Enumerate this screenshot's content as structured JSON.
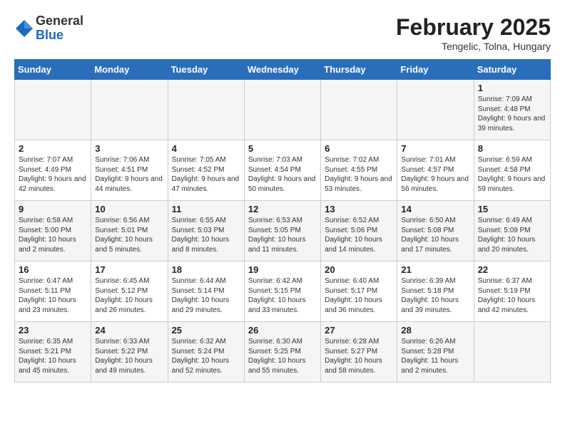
{
  "header": {
    "logo_general": "General",
    "logo_blue": "Blue",
    "title": "February 2025",
    "subtitle": "Tengelic, Tolna, Hungary"
  },
  "days_of_week": [
    "Sunday",
    "Monday",
    "Tuesday",
    "Wednesday",
    "Thursday",
    "Friday",
    "Saturday"
  ],
  "weeks": [
    [
      {
        "day": "",
        "info": ""
      },
      {
        "day": "",
        "info": ""
      },
      {
        "day": "",
        "info": ""
      },
      {
        "day": "",
        "info": ""
      },
      {
        "day": "",
        "info": ""
      },
      {
        "day": "",
        "info": ""
      },
      {
        "day": "1",
        "info": "Sunrise: 7:09 AM\nSunset: 4:48 PM\nDaylight: 9 hours and 39 minutes."
      }
    ],
    [
      {
        "day": "2",
        "info": "Sunrise: 7:07 AM\nSunset: 4:49 PM\nDaylight: 9 hours and 42 minutes."
      },
      {
        "day": "3",
        "info": "Sunrise: 7:06 AM\nSunset: 4:51 PM\nDaylight: 9 hours and 44 minutes."
      },
      {
        "day": "4",
        "info": "Sunrise: 7:05 AM\nSunset: 4:52 PM\nDaylight: 9 hours and 47 minutes."
      },
      {
        "day": "5",
        "info": "Sunrise: 7:03 AM\nSunset: 4:54 PM\nDaylight: 9 hours and 50 minutes."
      },
      {
        "day": "6",
        "info": "Sunrise: 7:02 AM\nSunset: 4:55 PM\nDaylight: 9 hours and 53 minutes."
      },
      {
        "day": "7",
        "info": "Sunrise: 7:01 AM\nSunset: 4:57 PM\nDaylight: 9 hours and 56 minutes."
      },
      {
        "day": "8",
        "info": "Sunrise: 6:59 AM\nSunset: 4:58 PM\nDaylight: 9 hours and 59 minutes."
      }
    ],
    [
      {
        "day": "9",
        "info": "Sunrise: 6:58 AM\nSunset: 5:00 PM\nDaylight: 10 hours and 2 minutes."
      },
      {
        "day": "10",
        "info": "Sunrise: 6:56 AM\nSunset: 5:01 PM\nDaylight: 10 hours and 5 minutes."
      },
      {
        "day": "11",
        "info": "Sunrise: 6:55 AM\nSunset: 5:03 PM\nDaylight: 10 hours and 8 minutes."
      },
      {
        "day": "12",
        "info": "Sunrise: 6:53 AM\nSunset: 5:05 PM\nDaylight: 10 hours and 11 minutes."
      },
      {
        "day": "13",
        "info": "Sunrise: 6:52 AM\nSunset: 5:06 PM\nDaylight: 10 hours and 14 minutes."
      },
      {
        "day": "14",
        "info": "Sunrise: 6:50 AM\nSunset: 5:08 PM\nDaylight: 10 hours and 17 minutes."
      },
      {
        "day": "15",
        "info": "Sunrise: 6:49 AM\nSunset: 5:09 PM\nDaylight: 10 hours and 20 minutes."
      }
    ],
    [
      {
        "day": "16",
        "info": "Sunrise: 6:47 AM\nSunset: 5:11 PM\nDaylight: 10 hours and 23 minutes."
      },
      {
        "day": "17",
        "info": "Sunrise: 6:45 AM\nSunset: 5:12 PM\nDaylight: 10 hours and 26 minutes."
      },
      {
        "day": "18",
        "info": "Sunrise: 6:44 AM\nSunset: 5:14 PM\nDaylight: 10 hours and 29 minutes."
      },
      {
        "day": "19",
        "info": "Sunrise: 6:42 AM\nSunset: 5:15 PM\nDaylight: 10 hours and 33 minutes."
      },
      {
        "day": "20",
        "info": "Sunrise: 6:40 AM\nSunset: 5:17 PM\nDaylight: 10 hours and 36 minutes."
      },
      {
        "day": "21",
        "info": "Sunrise: 6:39 AM\nSunset: 5:18 PM\nDaylight: 10 hours and 39 minutes."
      },
      {
        "day": "22",
        "info": "Sunrise: 6:37 AM\nSunset: 5:19 PM\nDaylight: 10 hours and 42 minutes."
      }
    ],
    [
      {
        "day": "23",
        "info": "Sunrise: 6:35 AM\nSunset: 5:21 PM\nDaylight: 10 hours and 45 minutes."
      },
      {
        "day": "24",
        "info": "Sunrise: 6:33 AM\nSunset: 5:22 PM\nDaylight: 10 hours and 49 minutes."
      },
      {
        "day": "25",
        "info": "Sunrise: 6:32 AM\nSunset: 5:24 PM\nDaylight: 10 hours and 52 minutes."
      },
      {
        "day": "26",
        "info": "Sunrise: 6:30 AM\nSunset: 5:25 PM\nDaylight: 10 hours and 55 minutes."
      },
      {
        "day": "27",
        "info": "Sunrise: 6:28 AM\nSunset: 5:27 PM\nDaylight: 10 hours and 58 minutes."
      },
      {
        "day": "28",
        "info": "Sunrise: 6:26 AM\nSunset: 5:28 PM\nDaylight: 11 hours and 2 minutes."
      },
      {
        "day": "",
        "info": ""
      }
    ]
  ]
}
